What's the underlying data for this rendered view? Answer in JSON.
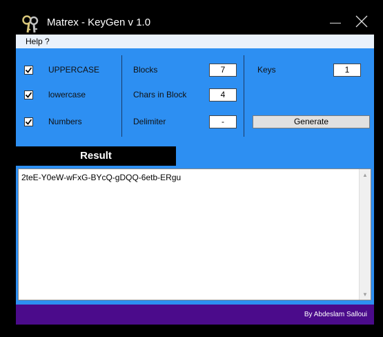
{
  "window": {
    "title": "Matrex - KeyGen v 1.0",
    "minimize_icon": "minimize-icon",
    "close_icon": "close-icon",
    "app_icon": "keys-icon"
  },
  "menu": {
    "help_label": "Help ?"
  },
  "options": {
    "uppercase_label": "UPPERCASE",
    "uppercase_checked": true,
    "lowercase_label": "lowercase",
    "lowercase_checked": true,
    "numbers_label": "Numbers",
    "numbers_checked": true
  },
  "settings": {
    "blocks_label": "Blocks",
    "blocks_value": "7",
    "chars_label": "Chars in Block",
    "chars_value": "4",
    "delimiter_label": "Delimiter",
    "delimiter_value": "-",
    "keys_label": "Keys",
    "keys_value": "1",
    "generate_label": "Generate"
  },
  "result": {
    "header": "Result",
    "text": "2teE-Y0eW-wFxG-BYcQ-gDQQ-6etb-ERgu"
  },
  "footer": {
    "credit": "By Abdeslam Salloui"
  },
  "colors": {
    "form_bg": "#2d8ff2",
    "titlebar_bg": "#000000",
    "footer_bg": "#4b0b8b",
    "menubar_bg": "#e9f1fb"
  }
}
